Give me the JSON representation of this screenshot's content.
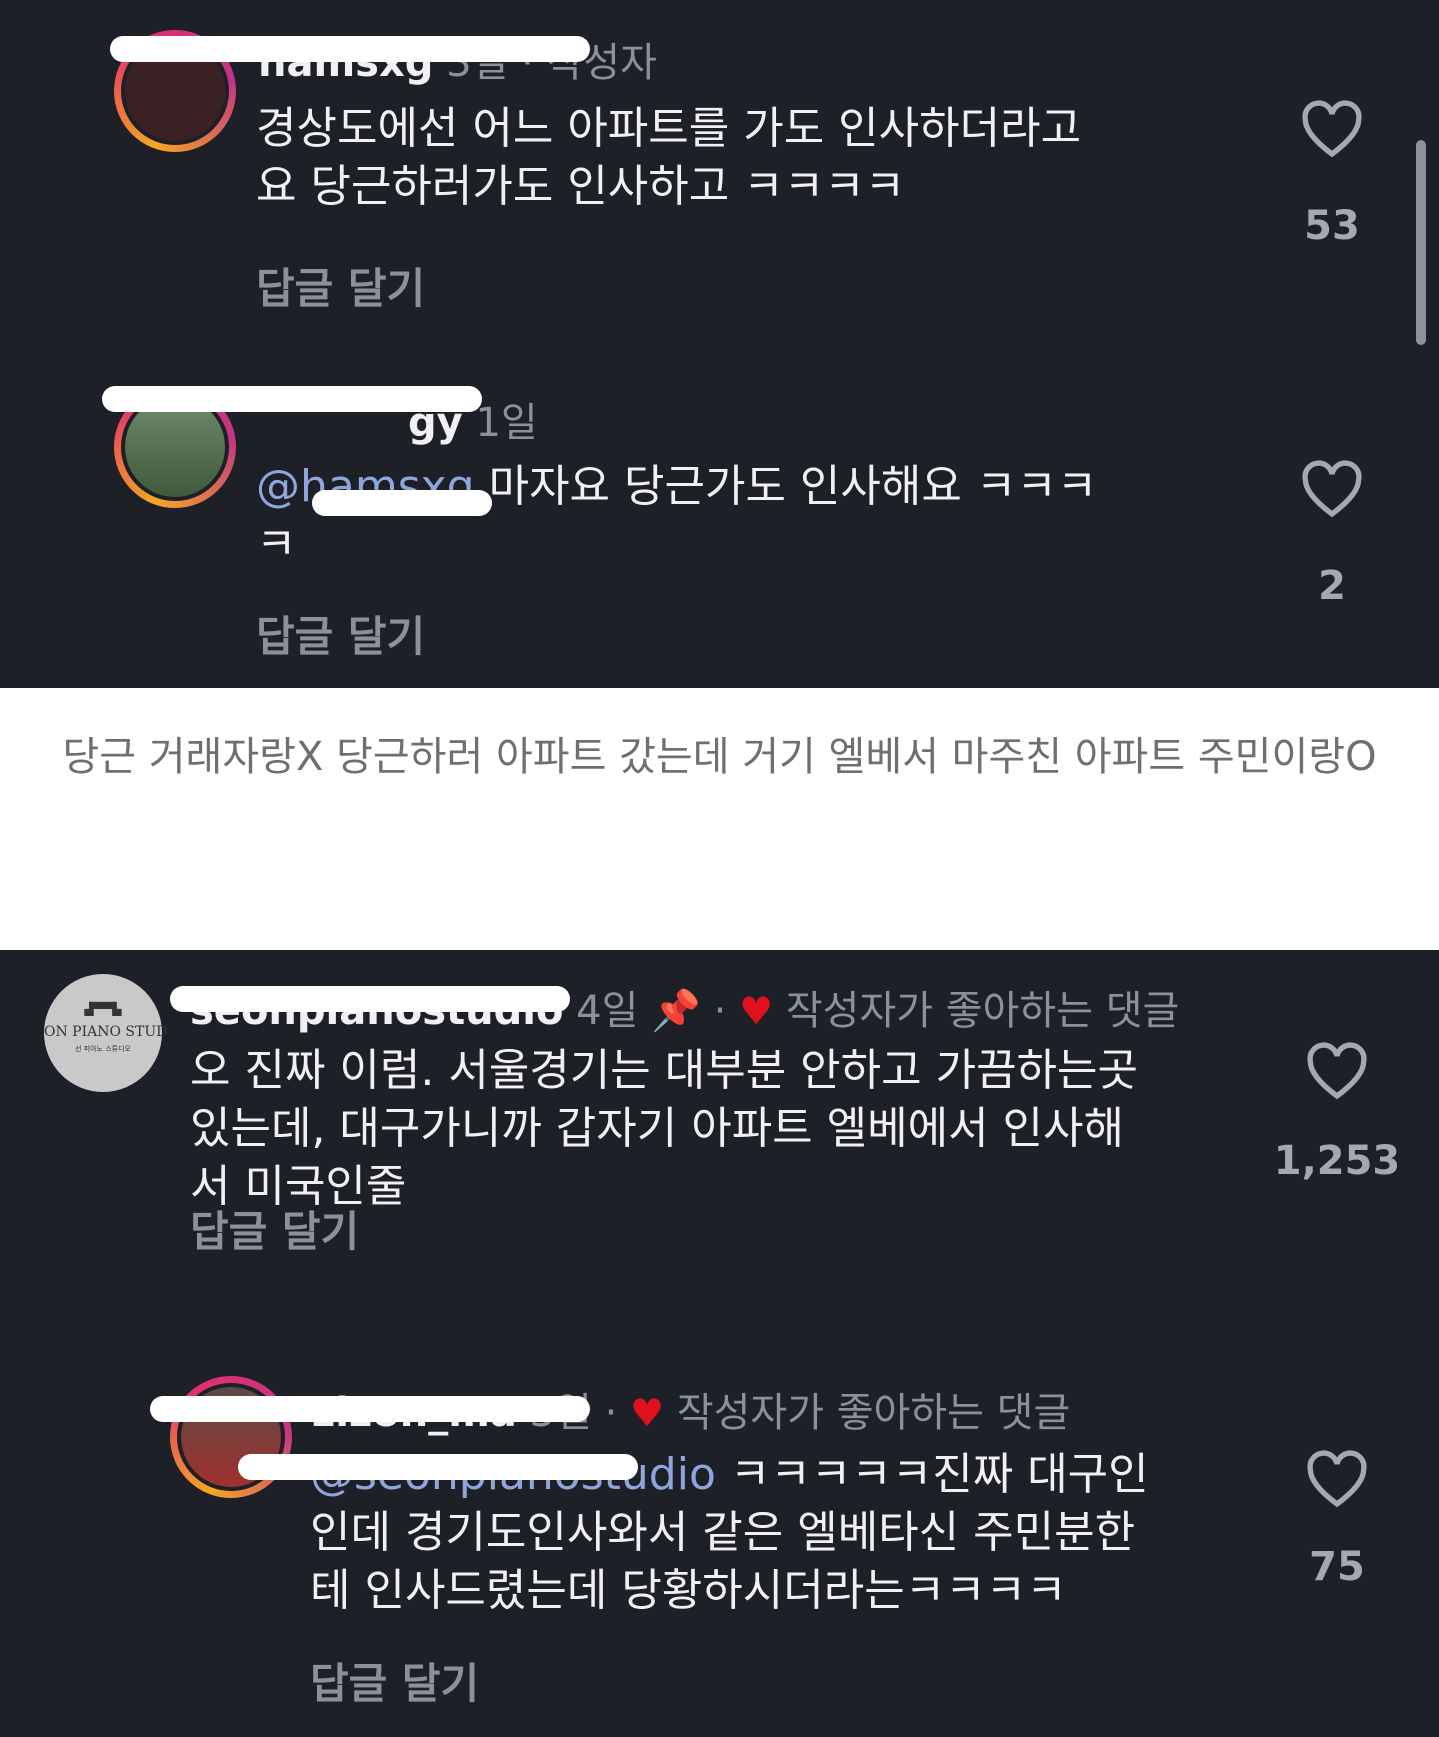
{
  "comments_top": [
    {
      "username": "namsxg",
      "meta": "3일 · 작성자",
      "text": "경상도에선 어느 아파트를 가도 인사하더라고\n요 당근하러가도 인사하고 ㅋㅋㅋㅋ",
      "reply_label": "답글 달기",
      "like_count": "53"
    },
    {
      "username": "gy",
      "meta": "1일",
      "mention": "@hamsxg",
      "text": " 마자요 당근가도 인사해요 ㅋㅋㅋ\nㅋ",
      "reply_label": "답글 달기",
      "like_count": "2"
    }
  ],
  "caption": "당근 거래자랑X 당근하러 아파트 갔는데 거기 엘베서 마주친 아파트 주민이랑O",
  "comments_bottom": [
    {
      "username": "seonpianostudio",
      "meta_time": "4일",
      "meta_tag": "작성자가 좋아하는 댓글",
      "avatar_text": "ON PIANO STUD",
      "avatar_subtext": "선 피아노 스튜디오",
      "text": "오 진짜 이럼. 서울경기는 대부분 안하고 가끔하는곳\n있는데, 대구가니까 갑자기 아파트 엘베에서 인사해\n서 미국인줄",
      "reply_label": "답글 달기",
      "like_count": "1,253"
    },
    {
      "username": "zizon_ma",
      "meta_time": "3일",
      "meta_tag": "작성자가 좋아하는 댓글",
      "mention": "@seonpianostudio",
      "text": " ㅋㅋㅋㅋㅋ진짜 대구인\n인데 경기도인사와서 같은 엘베타신 주민분한\n테 인사드렸는데 당황하시더라는ㅋㅋㅋㅋ",
      "reply_label": "답글 달기",
      "like_count": "75"
    }
  ],
  "colors": {
    "panel_bg": "#1e2028",
    "text": "#f1f1f3",
    "muted": "#8e9098",
    "mention": "#8fa6dd",
    "liked_heart": "#e0101e"
  },
  "icons": [
    "heart-outline-icon",
    "heart-filled-icon",
    "pin-icon",
    "avatar-ring"
  ]
}
